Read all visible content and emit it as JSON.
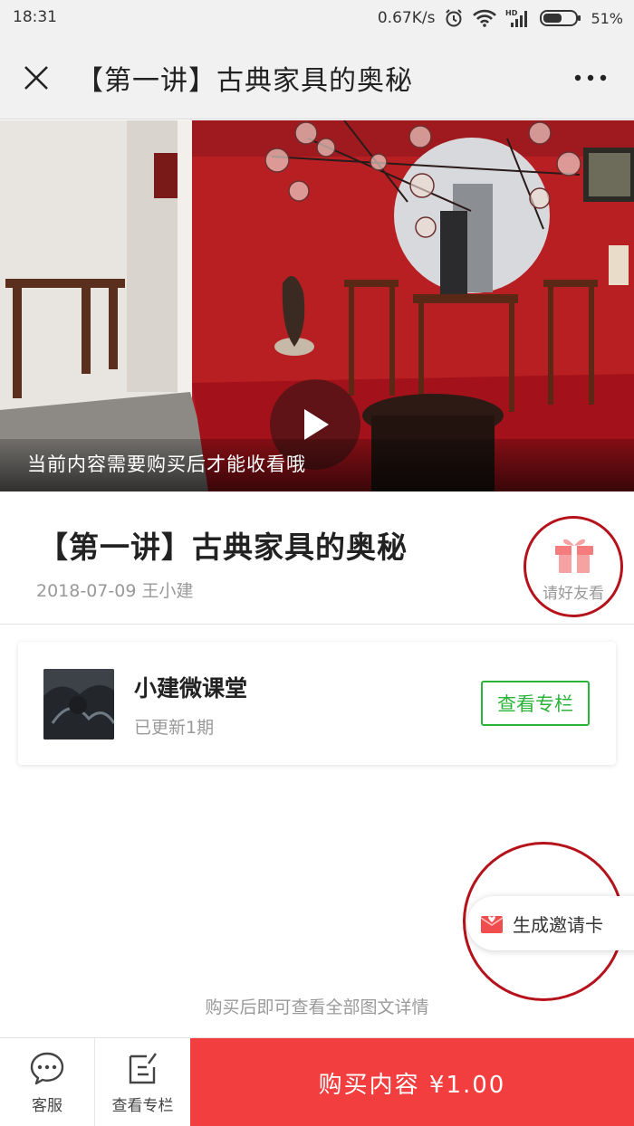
{
  "status_bar": {
    "time": "18:31",
    "network_speed": "0.67K/s",
    "battery": "51%",
    "icons": [
      "alarm-icon",
      "wifi-icon",
      "hd-signal-icon",
      "battery-icon"
    ]
  },
  "nav": {
    "title": "【第一讲】古典家具的奥秘",
    "close_icon": "close-icon",
    "more_icon": "more-icon"
  },
  "video": {
    "caption": "当前内容需要购买后才能收看哦",
    "play_icon": "play-icon"
  },
  "article": {
    "title": "【第一讲】古典家具的奥秘",
    "meta": "2018-07-09 王小建",
    "gift_label": "请好友看",
    "gift_icon": "gift-icon"
  },
  "column_card": {
    "name": "小建微课堂",
    "update": "已更新1期",
    "button": "查看专栏"
  },
  "invite": {
    "label": "生成邀请卡",
    "icon": "envelope-icon"
  },
  "purchase_hint": "购买后即可查看全部图文详情",
  "bottom_bar": {
    "service_label": "客服",
    "service_icon": "chat-icon",
    "column_label": "查看专栏",
    "column_icon": "edit-note-icon",
    "buy_label": "购买内容 ¥1.00"
  },
  "colors": {
    "accent_red": "#f23e3e",
    "annotation_red": "#b5121b",
    "green": "#2bb33a",
    "gift_pink": "#f6a2a2"
  }
}
